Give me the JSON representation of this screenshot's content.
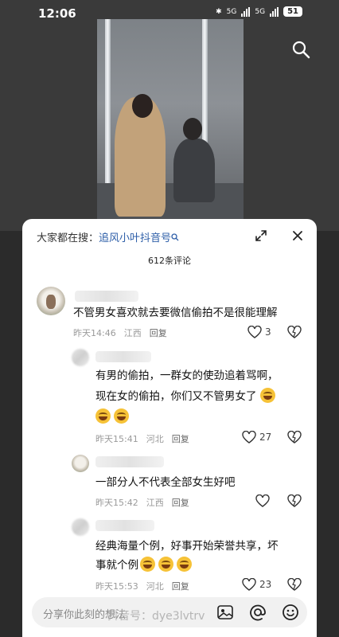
{
  "status_bar": {
    "time": "12:06",
    "network1": "5G",
    "network2": "5G",
    "battery": "51"
  },
  "comments_panel": {
    "hot_search_prefix": "大家都在搜：",
    "hot_search_keyword": "追风小叶抖音号",
    "count_label": "612条评论",
    "comments": [
      {
        "text": "不管男女喜欢就去要微信偷拍不是很能理解",
        "time": "昨天14:46",
        "location": "江西",
        "reply": "回复",
        "likes": "3"
      },
      {
        "text_line1": "有男的偷拍，一群女的使劲追着骂啊，",
        "text_line2": "现在女的偷拍，你们又不管男女了",
        "time": "昨天15:41",
        "location": "河北",
        "reply": "回复",
        "likes": "27"
      },
      {
        "text": "一部分人不代表全部女生好吧",
        "time": "昨天15:42",
        "location": "江西",
        "reply": "回复",
        "likes": ""
      },
      {
        "text_line1": "经典海量个例，好事开始荣誉共享，坏",
        "text_line2": "事就个例",
        "time": "昨天15:53",
        "location": "河北",
        "reply": "回复",
        "likes": "23"
      }
    ]
  },
  "input_bar": {
    "placeholder": "分享你此刻的想法"
  },
  "watermark": "抖音号：dye3lvtrv"
}
